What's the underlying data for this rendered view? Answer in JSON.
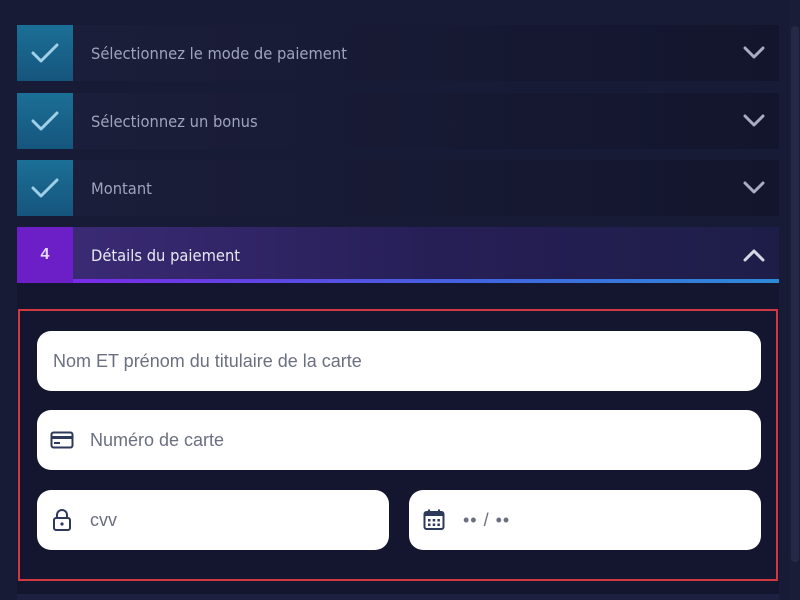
{
  "steps": [
    {
      "state": "done",
      "title": "Sélectionnez le mode de paiement"
    },
    {
      "state": "done",
      "title": "Sélectionnez un bonus"
    },
    {
      "state": "done",
      "title": "Montant"
    },
    {
      "state": "active",
      "number": "4",
      "title": "Détails du paiement"
    }
  ],
  "form": {
    "cardholder_placeholder": "Nom ET prénom du titulaire de la carte",
    "card_number_placeholder": "Numéro de carte",
    "cvv_placeholder": "cvv",
    "expiry_placeholder": "•• / ••"
  },
  "icons": {
    "done": "check-icon",
    "collapsed": "chevron-down-icon",
    "expanded": "chevron-up-icon",
    "card": "credit-card-icon",
    "cvv": "lock-icon",
    "expiry": "calendar-icon"
  },
  "colors": {
    "done_badge": "#15557d",
    "active_badge": "#6c1ec7",
    "highlight_border": "#d2383f",
    "background": "#181b36"
  }
}
